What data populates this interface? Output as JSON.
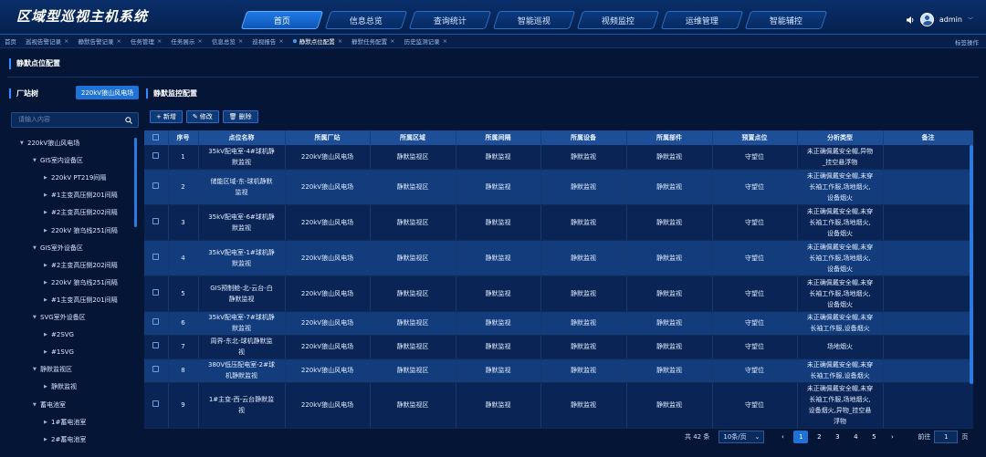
{
  "app": {
    "title": "区域型巡视主机系统"
  },
  "nav": [
    {
      "label": "首页",
      "active": true
    },
    {
      "label": "信息总览"
    },
    {
      "label": "查询统计"
    },
    {
      "label": "智能巡视"
    },
    {
      "label": "视频监控"
    },
    {
      "label": "运维管理"
    },
    {
      "label": "智能辅控"
    }
  ],
  "user": {
    "name": "admin"
  },
  "open_tabs": [
    {
      "label": "首页",
      "closable": false
    },
    {
      "label": "巡视告警记录",
      "closable": true
    },
    {
      "label": "静默告警记录",
      "closable": true
    },
    {
      "label": "任务管理",
      "closable": true
    },
    {
      "label": "任务展示",
      "closable": true
    },
    {
      "label": "信息总览",
      "closable": true
    },
    {
      "label": "巡视报告",
      "closable": true
    },
    {
      "label": "静默点位配置",
      "closable": true,
      "active": true
    },
    {
      "label": "静默任务配置",
      "closable": true
    },
    {
      "label": "历史监测记录",
      "closable": true
    }
  ],
  "tab_ops": "标签操作",
  "page_title": "静默点位配置",
  "left": {
    "title": "厂站树",
    "station_button": "220kV狼山风电场",
    "search_placeholder": "请输入内容",
    "tree": [
      {
        "label": "220kV狼山风电场",
        "level": 0,
        "expanded": true
      },
      {
        "label": "GIS室内设备区",
        "level": 1,
        "expanded": true
      },
      {
        "label": "220kV PT219间隔",
        "level": 2
      },
      {
        "label": "#1主变高压侧201间隔",
        "level": 2
      },
      {
        "label": "#2主变高压侧202间隔",
        "level": 2
      },
      {
        "label": "220kV 狼乌线251间隔",
        "level": 2
      },
      {
        "label": "GIS室外设备区",
        "level": 1,
        "expanded": true
      },
      {
        "label": "#2主变高压侧202间隔",
        "level": 2
      },
      {
        "label": "220kV 狼乌线251间隔",
        "level": 2
      },
      {
        "label": "#1主变高压侧201间隔",
        "level": 2
      },
      {
        "label": "SVG室外设备区",
        "level": 1,
        "expanded": true
      },
      {
        "label": "#2SVG",
        "level": 2
      },
      {
        "label": "#1SVG",
        "level": 2
      },
      {
        "label": "静默监视区",
        "level": 1,
        "expanded": true
      },
      {
        "label": "静默监视",
        "level": 2
      },
      {
        "label": "蓄电池室",
        "level": 1,
        "expanded": true
      },
      {
        "label": "1#蓄电池室",
        "level": 2
      },
      {
        "label": "2#蓄电池室",
        "level": 2
      }
    ]
  },
  "right": {
    "title": "静默监控配置",
    "buttons": {
      "add": "新增",
      "edit": "修改",
      "delete": "删除"
    },
    "columns": [
      "序号",
      "点位名称",
      "所属厂站",
      "所属区域",
      "所属间隔",
      "所属设备",
      "所属部件",
      "预置点位",
      "分析类型",
      "备注"
    ],
    "rows": [
      {
        "no": "1",
        "name": [
          "35kV配电室-4#球机静",
          "默监视"
        ],
        "station": "220kV狼山风电场",
        "area": "静默监视区",
        "bay": "静默监视",
        "device": "静默监视",
        "part": "静默监视",
        "preset": "守望位",
        "analysis": [
          "未正确佩戴安全帽,异物",
          "_挂空悬浮物"
        ],
        "remark": ""
      },
      {
        "no": "2",
        "name": [
          "储能区域-东-球机静默",
          "监视"
        ],
        "station": "220kV狼山风电场",
        "area": "静默监视区",
        "bay": "静默监视",
        "device": "静默监视",
        "part": "静默监视",
        "preset": "守望位",
        "analysis": [
          "未正确佩戴安全帽,未穿",
          "长袖工作服,场地烟火,",
          "设备烟火"
        ],
        "remark": ""
      },
      {
        "no": "3",
        "name": [
          "35kV配电室-6#球机静",
          "默监视"
        ],
        "station": "220kV狼山风电场",
        "area": "静默监视区",
        "bay": "静默监视",
        "device": "静默监视",
        "part": "静默监视",
        "preset": "守望位",
        "analysis": [
          "未正确佩戴安全帽,未穿",
          "长袖工作服,场地烟火,",
          "设备烟火"
        ],
        "remark": ""
      },
      {
        "no": "4",
        "name": [
          "35kV配电室-1#球机静",
          "默监视"
        ],
        "station": "220kV狼山风电场",
        "area": "静默监视区",
        "bay": "静默监视",
        "device": "静默监视",
        "part": "静默监视",
        "preset": "守望位",
        "analysis": [
          "未正确佩戴安全帽,未穿",
          "长袖工作服,场地烟火,",
          "设备烟火"
        ],
        "remark": ""
      },
      {
        "no": "5",
        "name": [
          "GIS预制舱-北-云台-白",
          "静默监视"
        ],
        "station": "220kV狼山风电场",
        "area": "静默监视区",
        "bay": "静默监视",
        "device": "静默监视",
        "part": "静默监视",
        "preset": "守望位",
        "analysis": [
          "未正确佩戴安全帽,未穿",
          "长袖工作服,场地烟火,",
          "设备烟火"
        ],
        "remark": ""
      },
      {
        "no": "6",
        "name": [
          "35kV配电室-7#球机静",
          "默监视"
        ],
        "station": "220kV狼山风电场",
        "area": "静默监视区",
        "bay": "静默监视",
        "device": "静默监视",
        "part": "静默监视",
        "preset": "守望位",
        "analysis": [
          "未正确佩戴安全帽,未穿",
          "长袖工作服,设备烟火"
        ],
        "remark": ""
      },
      {
        "no": "7",
        "name": [
          "周界-东北-球机静默监",
          "视"
        ],
        "station": "220kV狼山风电场",
        "area": "静默监视区",
        "bay": "静默监视",
        "device": "静默监视",
        "part": "静默监视",
        "preset": "守望位",
        "analysis": [
          "场地烟火"
        ],
        "remark": ""
      },
      {
        "no": "8",
        "name": [
          "380V低压配电室-2#球",
          "机静默监视"
        ],
        "station": "220kV狼山风电场",
        "area": "静默监视区",
        "bay": "静默监视",
        "device": "静默监视",
        "part": "静默监视",
        "preset": "守望位",
        "analysis": [
          "未正确佩戴安全帽,未穿",
          "长袖工作服,设备烟火"
        ],
        "remark": ""
      },
      {
        "no": "9",
        "name": [
          "1#主变-西-云台静默监",
          "视"
        ],
        "station": "220kV狼山风电场",
        "area": "静默监视区",
        "bay": "静默监视",
        "device": "静默监视",
        "part": "静默监视",
        "preset": "守望位",
        "analysis": [
          "未正确佩戴安全帽,未穿",
          "长袖工作服,场地烟火,",
          "设备烟火,异物_挂空悬",
          "浮物"
        ],
        "remark": ""
      }
    ]
  },
  "pagination": {
    "total": "共 42 条",
    "page_size": "10条/页",
    "pages": [
      "1",
      "2",
      "3",
      "4",
      "5"
    ],
    "current": "1",
    "goto_label": "前往",
    "goto_value": "1",
    "page_unit": "页"
  },
  "colors": {
    "bg": "#041536",
    "accent": "#1f73d6",
    "header": "#1d4f98"
  }
}
